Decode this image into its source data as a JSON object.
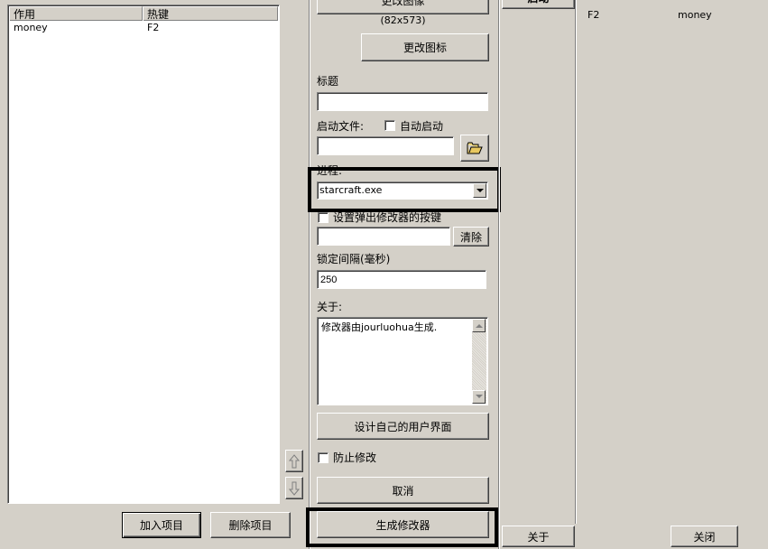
{
  "list": {
    "columns": [
      "作用",
      "热键"
    ],
    "rows": [
      {
        "action": "money",
        "hotkey": "F2"
      }
    ]
  },
  "buttons": {
    "add_item": "加入项目",
    "delete_item": "删除项目",
    "change_image": "更改图像",
    "change_icon": "更改图标",
    "clear": "清除",
    "design_ui": "设计自己的用户界面",
    "cancel": "取消",
    "generate": "生成修改器",
    "start": "启动",
    "about": "关于",
    "close": "关闭"
  },
  "image_size": "(82x573)",
  "form": {
    "title_label": "标题",
    "title_value": "",
    "startup_file_label": "启动文件:",
    "auto_start_label": "自动启动",
    "startup_file_value": "",
    "process_label": "进程:",
    "process_value": "starcraft.exe",
    "popup_hotkey_label": "设置弹出修改器的按键",
    "popup_hotkey_value": "",
    "lock_interval_label": "锁定间隔(毫秒)",
    "lock_interval_value": "250",
    "about_label": "关于:",
    "about_text": "修改器由jourluohua生成.",
    "prevent_modify_label": "防止修改"
  },
  "preview": {
    "hotkey": "F2",
    "action": "money"
  }
}
